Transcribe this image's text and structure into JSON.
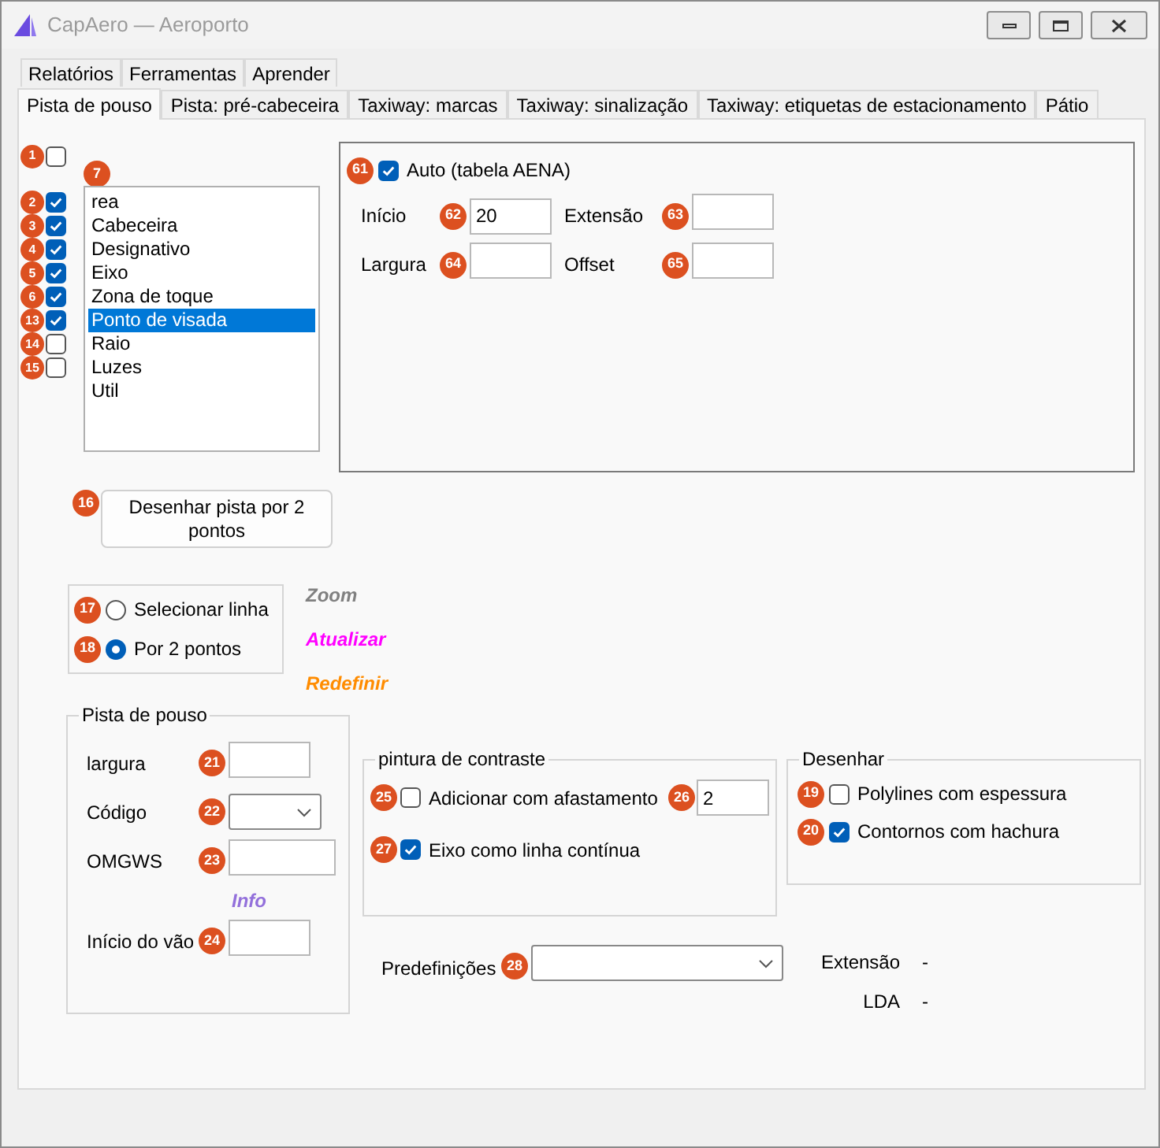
{
  "window": {
    "title": "CapAero — Aeroporto"
  },
  "menu_tabs": [
    {
      "label": "Relatórios"
    },
    {
      "label": "Ferramentas"
    },
    {
      "label": "Aprender"
    }
  ],
  "tabs": [
    {
      "label": "Pista de pouso",
      "selected": true
    },
    {
      "label": "Pista: pré-cabeceira",
      "selected": false
    },
    {
      "label": "Taxiway: marcas",
      "selected": false
    },
    {
      "label": "Taxiway: sinalização",
      "selected": false
    },
    {
      "label": "Taxiway: etiquetas de estacionamento",
      "selected": false
    },
    {
      "label": "Pátio",
      "selected": false
    }
  ],
  "top_checkbox": {
    "badge": "1",
    "checked": false
  },
  "layer_checkboxes": [
    {
      "badge": "2",
      "checked": true
    },
    {
      "badge": "3",
      "checked": true
    },
    {
      "badge": "4",
      "checked": true
    },
    {
      "badge": "5",
      "checked": true
    },
    {
      "badge": "6",
      "checked": true
    },
    {
      "badge": "13",
      "checked": true
    },
    {
      "badge": "14",
      "checked": false
    },
    {
      "badge": "15",
      "checked": false
    }
  ],
  "layer_list": {
    "badge": "7",
    "items": [
      {
        "label": "rea",
        "selected": false
      },
      {
        "label": "Cabeceira",
        "selected": false
      },
      {
        "label": "Designativo",
        "selected": false
      },
      {
        "label": "Eixo",
        "selected": false
      },
      {
        "label": "Zona de toque",
        "selected": false
      },
      {
        "label": "Ponto de visada",
        "selected": true
      },
      {
        "label": "Raio",
        "selected": false
      },
      {
        "label": "Luzes",
        "selected": false
      },
      {
        "label": "Util",
        "selected": false
      }
    ]
  },
  "auto_group": {
    "checkbox": {
      "badge": "61",
      "label": "Auto (tabela AENA)",
      "checked": true
    },
    "fields": [
      {
        "label": "Início",
        "badge": "62",
        "value": "20"
      },
      {
        "label": "Extensão",
        "badge": "63"
      },
      {
        "label": "Largura",
        "badge": "64"
      },
      {
        "label": "Offset",
        "badge": "65"
      }
    ]
  },
  "draw_button": {
    "badge": "16",
    "label": "Desenhar pista por 2 pontos"
  },
  "mode_radios": [
    {
      "badge": "17",
      "label": "Selecionar linha",
      "selected": false
    },
    {
      "badge": "18",
      "label": "Por 2 pontos",
      "selected": true
    }
  ],
  "links": [
    {
      "label": "Zoom",
      "color": "#808080"
    },
    {
      "label": "Atualizar",
      "color": "#ff00ff"
    },
    {
      "label": "Redefinir",
      "color": "#ff8c00"
    }
  ],
  "runway_group": {
    "title": "Pista de pouso",
    "rows": [
      {
        "kind": "input",
        "label": "largura",
        "badge": "21"
      },
      {
        "kind": "select",
        "label": "Código",
        "badge": "22"
      },
      {
        "kind": "wide_input",
        "label": "OMGWS",
        "badge": "23"
      },
      {
        "kind": "link",
        "label": "Info",
        "color": "#9370db"
      },
      {
        "kind": "input",
        "label": "Início do vão",
        "badge": "24"
      }
    ]
  },
  "contrast_group": {
    "title": "pintura de contraste",
    "options": [
      {
        "badge": "25",
        "label": "Adicionar com afastamento",
        "checked": false,
        "field": {
          "badge": "26",
          "value": "2"
        }
      },
      {
        "badge": "27",
        "label": "Eixo como linha contínua",
        "checked": true
      }
    ]
  },
  "draw_group": {
    "title": "Desenhar",
    "options": [
      {
        "badge": "19",
        "label": "Polylines com espessura",
        "checked": false
      },
      {
        "badge": "20",
        "label": "Contornos com hachura",
        "checked": true
      }
    ]
  },
  "presets": {
    "label": "Predefinições",
    "badge": "28"
  },
  "stats": [
    {
      "label": "Extensão",
      "value": "-"
    },
    {
      "label": "LDA",
      "value": "-"
    }
  ]
}
